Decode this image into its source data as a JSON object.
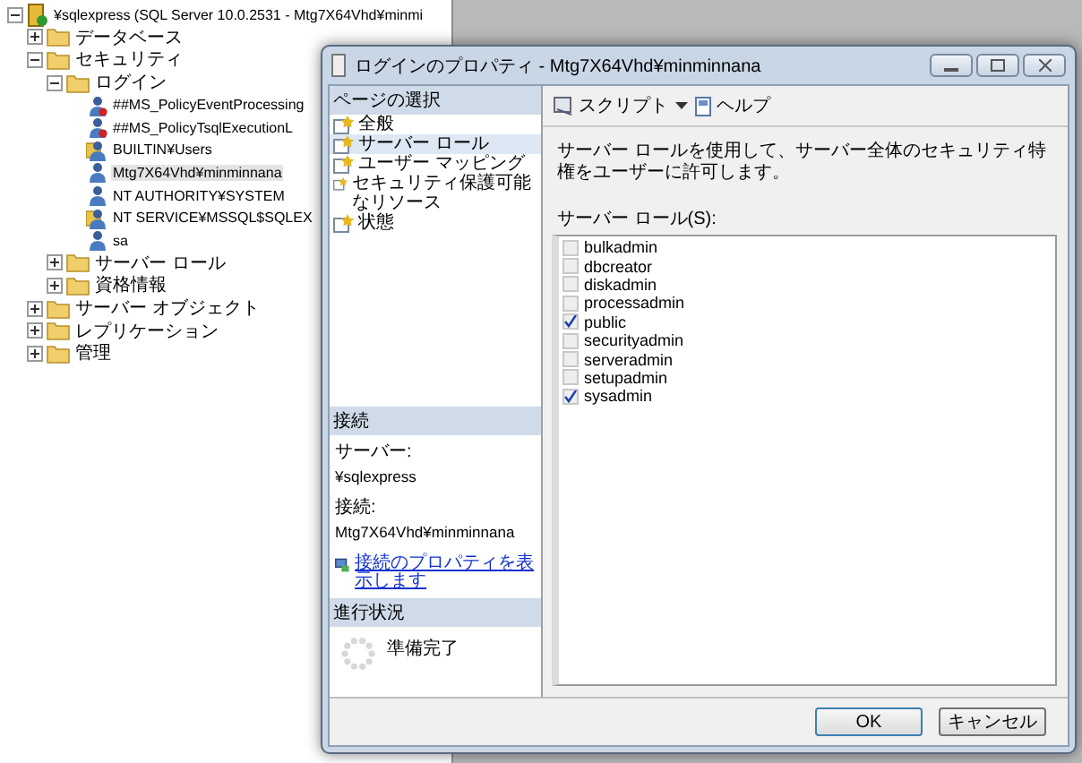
{
  "tree": [
    {
      "label": "¥sqlexpress (SQL Server 10.0.2531 - Mtg7X64Vhd¥minmi",
      "kind": "server",
      "expanded": true,
      "children": [
        {
          "label": "データベース",
          "kind": "folder",
          "expanded": false
        },
        {
          "label": "セキュリティ",
          "kind": "folder",
          "expanded": true,
          "children": [
            {
              "label": "ログイン",
              "kind": "folder",
              "expanded": true,
              "children": [
                {
                  "label": "##MS_PolicyEventProcessing",
                  "kind": "user-denied",
                  "selected": false
                },
                {
                  "label": "##MS_PolicyTsqlExecutionL",
                  "kind": "user-denied",
                  "selected": false
                },
                {
                  "label": "BUILTIN¥Users",
                  "kind": "group",
                  "selected": false
                },
                {
                  "label": "Mtg7X64Vhd¥minminnana",
                  "kind": "user",
                  "selected": true
                },
                {
                  "label": "NT AUTHORITY¥SYSTEM",
                  "kind": "user",
                  "selected": false
                },
                {
                  "label": "NT SERVICE¥MSSQL$SQLEX",
                  "kind": "group",
                  "selected": false
                },
                {
                  "label": "sa",
                  "kind": "user",
                  "selected": false
                }
              ]
            },
            {
              "label": "サーバー ロール",
              "kind": "folder",
              "expanded": false
            },
            {
              "label": "資格情報",
              "kind": "folder",
              "expanded": false
            }
          ]
        },
        {
          "label": "サーバー オブジェクト",
          "kind": "folder",
          "expanded": false
        },
        {
          "label": "レプリケーション",
          "kind": "folder",
          "expanded": false
        },
        {
          "label": "管理",
          "kind": "folder",
          "expanded": false
        }
      ]
    }
  ],
  "dialog": {
    "title": "ログインのプロパティ - Mtg7X64Vhd¥minminnana",
    "page_select": {
      "heading": "ページの選択",
      "pages": [
        {
          "label": "全般",
          "selected": false
        },
        {
          "label": "サーバー ロール",
          "selected": true
        },
        {
          "label": "ユーザー マッピング",
          "selected": false
        },
        {
          "label": "セキュリティ保護可能なリソース",
          "selected": false
        },
        {
          "label": "状態",
          "selected": false
        }
      ]
    },
    "connection": {
      "heading": "接続",
      "server_label": "サーバー:",
      "server": "¥sqlexpress",
      "connection_label": "接続:",
      "connection": "Mtg7X64Vhd¥minminnana",
      "link": "接続のプロパティを表示します"
    },
    "progress": {
      "heading": "進行状況",
      "status": "準備完了"
    },
    "toolbar": {
      "script": "スクリプト",
      "help": "ヘルプ"
    },
    "description": "サーバー ロールを使用して、サーバー全体のセキュリティ特権をユーザーに許可します。",
    "roles_label": "サーバー ロール(S):",
    "roles": [
      {
        "name": "bulkadmin",
        "checked": false
      },
      {
        "name": "dbcreator",
        "checked": false
      },
      {
        "name": "diskadmin",
        "checked": false
      },
      {
        "name": "processadmin",
        "checked": false
      },
      {
        "name": "public",
        "checked": true
      },
      {
        "name": "securityadmin",
        "checked": false
      },
      {
        "name": "serveradmin",
        "checked": false
      },
      {
        "name": "setupadmin",
        "checked": false
      },
      {
        "name": "sysadmin",
        "checked": true
      }
    ],
    "buttons": [
      "OK",
      "キャンセル"
    ]
  }
}
